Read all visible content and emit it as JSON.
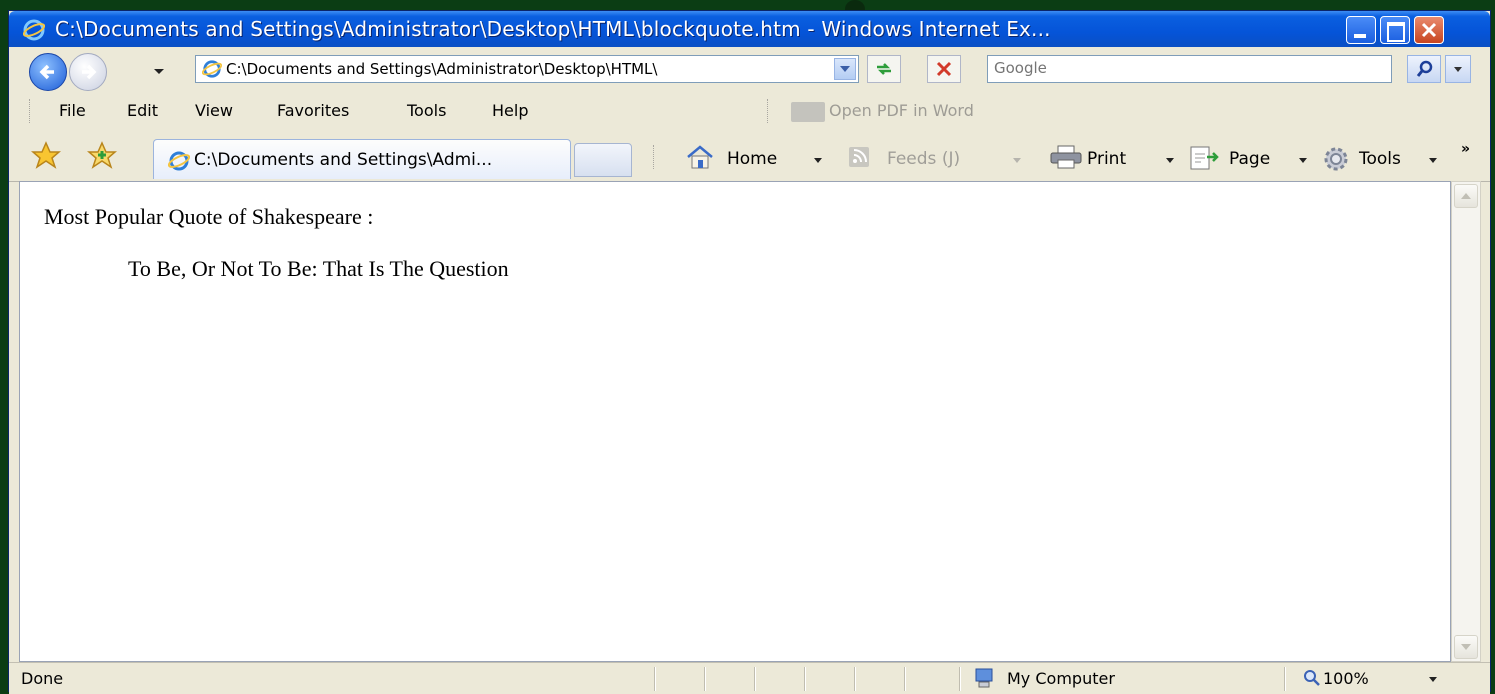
{
  "window": {
    "title": "C:\\Documents and Settings\\Administrator\\Desktop\\HTML\\blockquote.htm - Windows Internet Ex..."
  },
  "address_bar": {
    "url": "C:\\Documents and Settings\\Administrator\\Desktop\\HTML\\"
  },
  "search": {
    "placeholder": "Google"
  },
  "menu": {
    "file": "File",
    "edit": "Edit",
    "view": "View",
    "favorites": "Favorites",
    "tools": "Tools",
    "help": "Help",
    "open_pdf": "Open PDF in Word"
  },
  "tabs": [
    {
      "label": "C:\\Documents and Settings\\Admi..."
    }
  ],
  "commands": {
    "home": "Home",
    "feeds": "Feeds (J)",
    "print": "Print",
    "page": "Page",
    "tools": "Tools"
  },
  "document": {
    "heading": "Most Popular Quote of Shakespeare :",
    "blockquote": "To Be, Or Not To Be: That Is The Question"
  },
  "status": {
    "text": "Done",
    "zone": "My Computer",
    "zoom": "100%"
  },
  "colors": {
    "titlebar": "#0554d8",
    "chrome": "#ece9d8",
    "backdrop": "#0b3d14"
  },
  "icons": [
    "ie-logo-icon",
    "back-arrow-icon",
    "forward-arrow-icon",
    "refresh-icon",
    "stop-icon",
    "search-icon",
    "favorites-star-icon",
    "add-favorites-icon",
    "home-icon",
    "feeds-icon",
    "print-icon",
    "page-icon",
    "tools-gear-icon",
    "my-computer-icon",
    "zoom-icon"
  ]
}
